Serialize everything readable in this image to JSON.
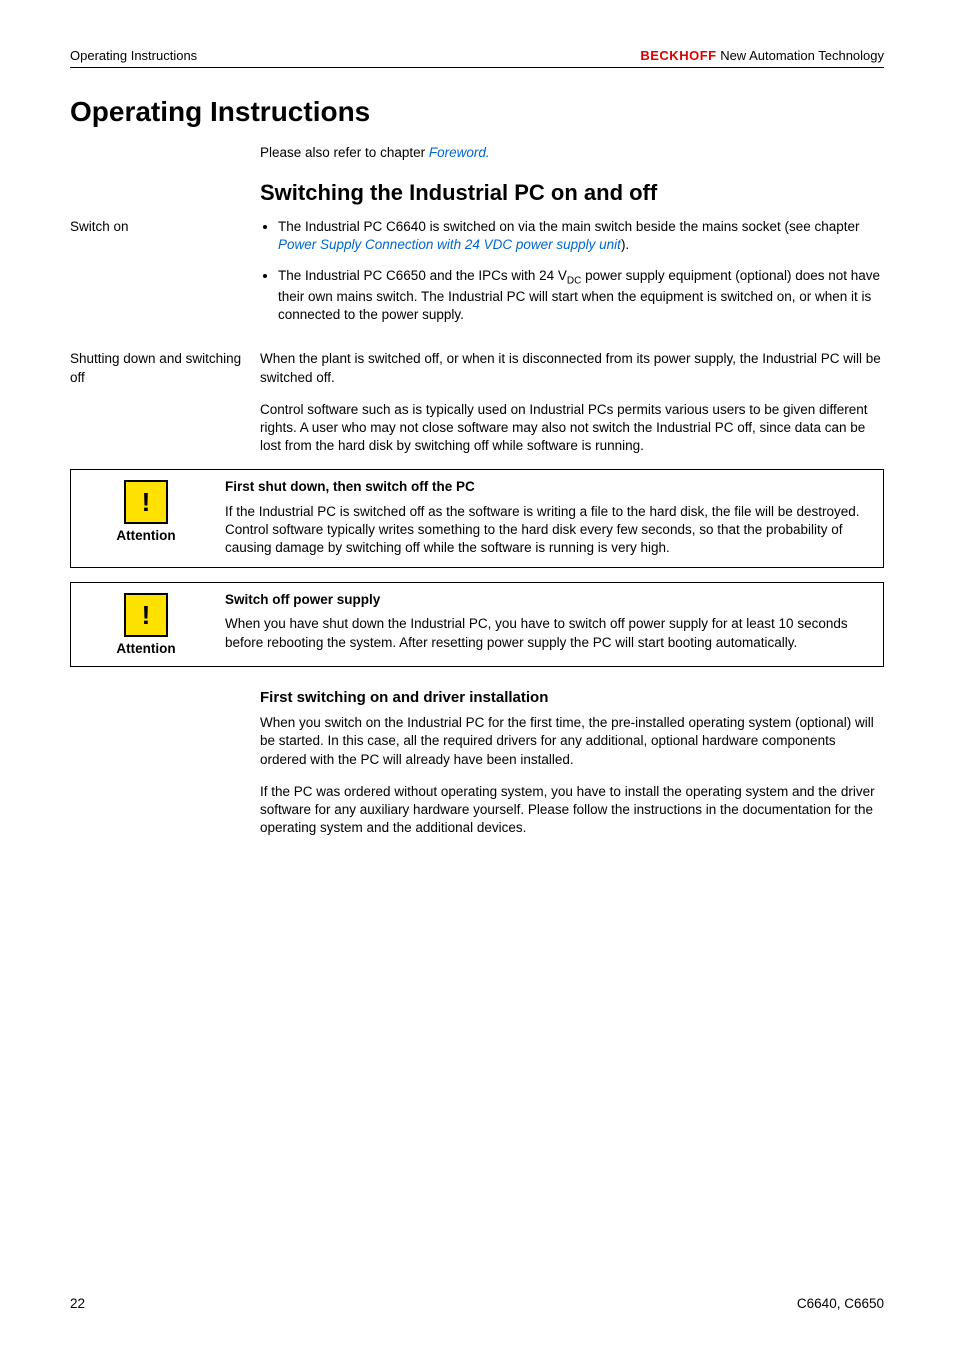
{
  "header": {
    "left": "Operating Instructions",
    "brand_red": "BECKHOFF",
    "brand_tag": " New Automation Technology"
  },
  "h1": "Operating Instructions",
  "intro_prefix": "Please also refer to chapter ",
  "intro_link": "Foreword.",
  "h2": "Switching the Industrial PC on and off",
  "switch_on": {
    "label": "Switch on",
    "b1_pre": "The Industrial PC C6640 is switched on via the main switch beside the mains socket (see chapter ",
    "b1_link": "Power Supply Connection with 24 VDC  power supply unit",
    "b1_post": ").",
    "b2_pre": "The Industrial PC C6650 and the IPCs with 24 V",
    "b2_sub": "DC",
    "b2_post": " power supply equipment (optional) does not have their own mains switch. The Industrial PC will start when the equipment is switched on, or when it is connected to the power supply."
  },
  "shutting": {
    "label": "Shutting down and switching off",
    "p1": "When the plant is switched off, or when it is disconnected from its power supply, the Industrial PC will be switched off.",
    "p2": "Control software such as is typically used on Industrial PCs permits various users to be given different rights. A user who may not close software may also not switch the Industrial PC off, since data can be lost from the hard disk by switching off while software is running."
  },
  "note1": {
    "label": "Attention",
    "title": "First shut down, then switch off the PC",
    "body": "If the Industrial PC is switched off as the software is writing a file to the hard disk, the file will be destroyed. Control software typically writes something to the hard disk every few seconds, so that the probability of causing damage by switching off while the software is running is very high."
  },
  "note2": {
    "label": "Attention",
    "title": "Switch off power supply",
    "body": "When you have shut down the Industrial PC, you have to switch off power supply for at least 10 seconds before rebooting the system. After resetting power supply the PC will start booting automatically."
  },
  "h3": "First switching on and driver installation",
  "first_p1": "When you switch on the Industrial PC for the first time, the pre-installed operating system (optional) will be started. In this case, all the required drivers for any additional, optional hardware components ordered with the PC will already have been installed.",
  "first_p2": "If the PC was ordered without operating system, you have to install the operating system and the driver software for any auxiliary hardware yourself. Please follow the instructions in the documentation for the operating system and the additional devices.",
  "footer": {
    "left": "22",
    "right": "C6640, C6650"
  }
}
